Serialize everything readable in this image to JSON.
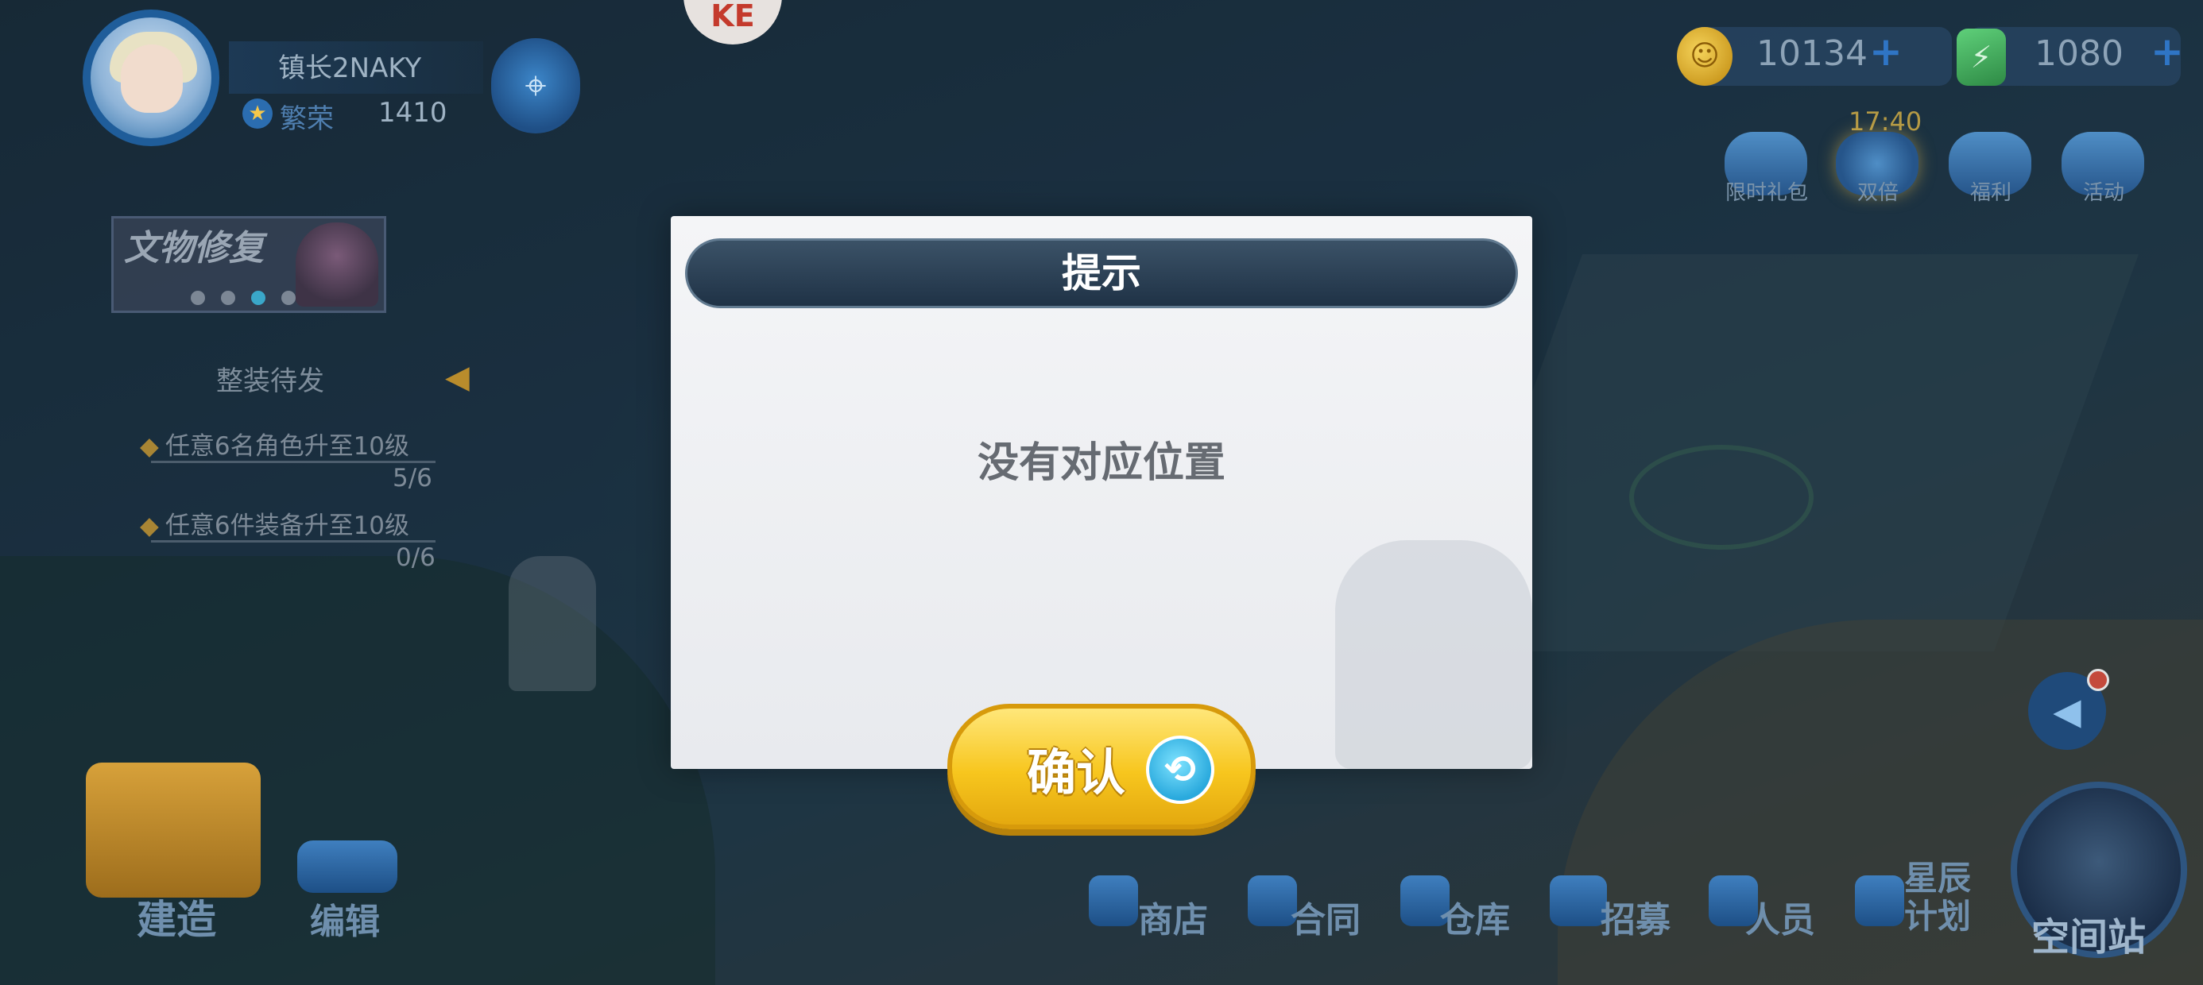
{
  "player": {
    "name": "镇长2NAKY",
    "prosperity_label": "繁荣",
    "prosperity_value": "1410"
  },
  "badge": {
    "text": "KE"
  },
  "quest": {
    "title": "文物修复",
    "status": "整装待发",
    "tasks": [
      {
        "text": "任意6名角色升至10级",
        "progress": "5/6"
      },
      {
        "text": "任意6件装备升至10级",
        "progress": "0/6"
      }
    ]
  },
  "currency": {
    "coins": "10134",
    "gems": "1080"
  },
  "events": {
    "timer": "17:40",
    "items": [
      {
        "label": "限时礼包",
        "icon": "gift-box-icon"
      },
      {
        "label": "双倍",
        "icon": "double-reward-icon"
      },
      {
        "label": "福利",
        "icon": "welfare-icon"
      },
      {
        "label": "活动",
        "icon": "activity-icon"
      }
    ]
  },
  "actions": {
    "build": "建造",
    "edit": "编辑"
  },
  "nav": {
    "items": [
      {
        "label": "商店",
        "icon": "cart-icon"
      },
      {
        "label": "合同",
        "icon": "contract-icon"
      },
      {
        "label": "仓库",
        "icon": "warehouse-icon"
      },
      {
        "label": "招募",
        "icon": "recruit-truck-icon"
      },
      {
        "label": "人员",
        "icon": "staff-icon"
      },
      {
        "label_line1": "星辰",
        "label_line2": "计划",
        "icon": "star-plan-icon"
      }
    ],
    "station": "空间站"
  },
  "dialog": {
    "title": "提示",
    "message": "没有对应位置",
    "confirm": "确认"
  },
  "colors": {
    "dialog_header": "#2c4256",
    "confirm_button": "#f7c61e",
    "accent_blue": "#2f75c5"
  }
}
